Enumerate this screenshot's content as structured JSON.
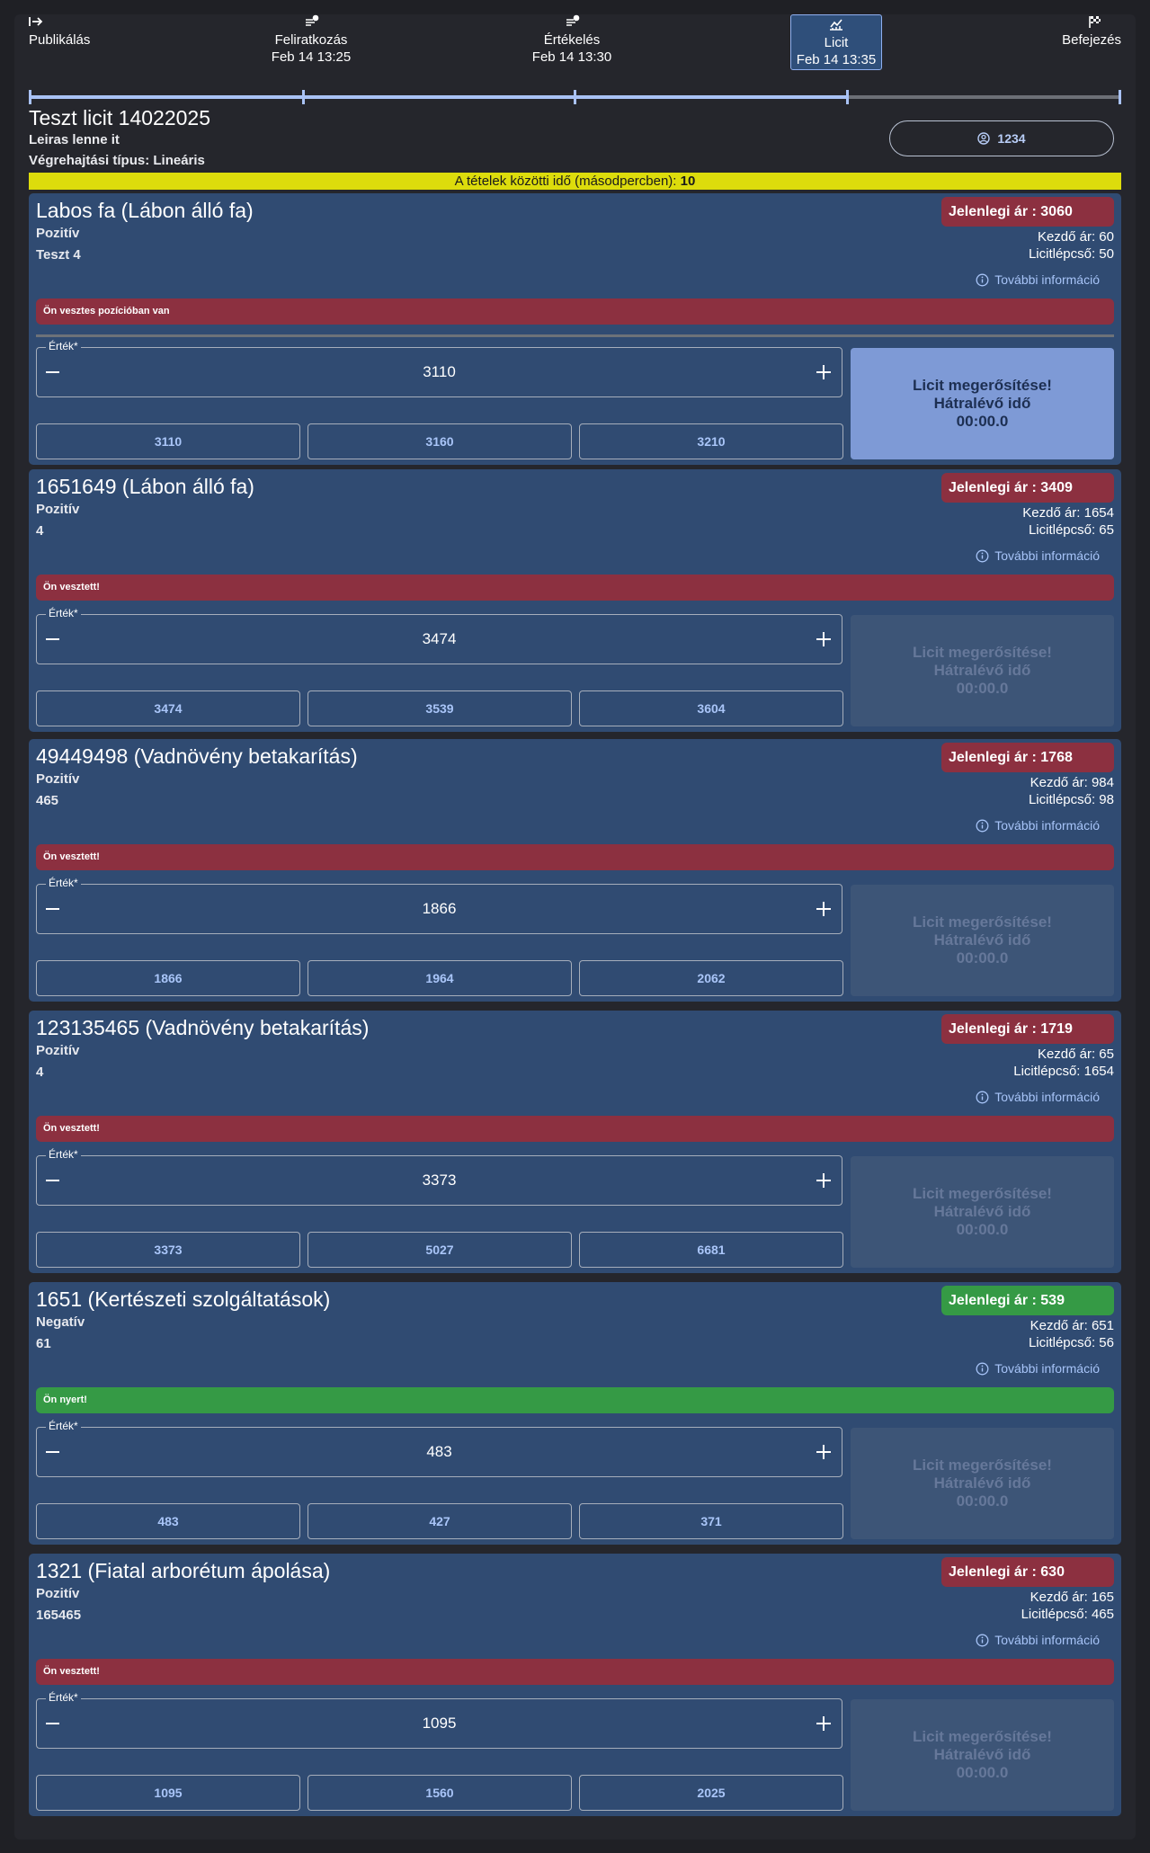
{
  "stepper": {
    "steps": [
      {
        "label": "Publikálás",
        "date": ""
      },
      {
        "label": "Feliratkozás",
        "date": "Feb 14 13:25"
      },
      {
        "label": "Értékelés",
        "date": "Feb 14 13:30"
      },
      {
        "label": "Licit",
        "date": "Feb 14 13:35"
      },
      {
        "label": "Befejezés",
        "date": ""
      }
    ],
    "active_index": 3
  },
  "header": {
    "title": "Teszt licit 14022025",
    "description": "Leiras lenne it",
    "type_label": "Végrehajtási típus: ",
    "type_value": "Lineáris",
    "user": "1234",
    "banner_text": "A tételek közötti idő (másodpercben): ",
    "banner_value": "10"
  },
  "labels": {
    "field": "Érték*",
    "info": "További információ",
    "confirm_line1": "Licit megerősítése!",
    "confirm_line2": "Hátralévő idő",
    "confirm_time": "00:00.0"
  },
  "colors": {
    "accent": "#a9c2f5",
    "lose": "#8c3040",
    "win": "#359a45",
    "banner": "#dddc0c"
  },
  "items": [
    {
      "title": "Labos fa (Lábon álló fa)",
      "type": "Pozitív",
      "sub": "Teszt 4",
      "price": "Jelenlegi ár : 3060",
      "start": "Kezdő ár: 60",
      "step": "Licitlépcső: 50",
      "status": "Ön vesztes pozícióban van",
      "win": false,
      "value": "3110",
      "quick": [
        "3110",
        "3160",
        "3210"
      ],
      "active": true
    },
    {
      "title": "1651649 (Lábon álló fa)",
      "type": "Pozitív",
      "sub": "4",
      "price": "Jelenlegi ár : 3409",
      "start": "Kezdő ár: 1654",
      "step": "Licitlépcső: 65",
      "status": "Ön vesztett!",
      "win": false,
      "value": "3474",
      "quick": [
        "3474",
        "3539",
        "3604"
      ],
      "active": false
    },
    {
      "title": "49449498 (Vadnövény betakarítás)",
      "type": "Pozitív",
      "sub": "465",
      "price": "Jelenlegi ár : 1768",
      "start": "Kezdő ár: 984",
      "step": "Licitlépcső: 98",
      "status": "Ön vesztett!",
      "win": false,
      "value": "1866",
      "quick": [
        "1866",
        "1964",
        "2062"
      ],
      "active": false
    },
    {
      "title": "123135465 (Vadnövény betakarítás)",
      "type": "Pozitív",
      "sub": "4",
      "price": "Jelenlegi ár : 1719",
      "start": "Kezdő ár: 65",
      "step": "Licitlépcső: 1654",
      "status": "Ön vesztett!",
      "win": false,
      "value": "3373",
      "quick": [
        "3373",
        "5027",
        "6681"
      ],
      "active": false
    },
    {
      "title": "1651 (Kertészeti szolgáltatások)",
      "type": "Negatív",
      "sub": "61",
      "price": "Jelenlegi ár : 539",
      "start": "Kezdő ár: 651",
      "step": "Licitlépcső: 56",
      "status": "Ön nyert!",
      "win": true,
      "value": "483",
      "quick": [
        "483",
        "427",
        "371"
      ],
      "active": false
    },
    {
      "title": "1321 (Fiatal arborétum ápolása)",
      "type": "Pozitív",
      "sub": "165465",
      "price": "Jelenlegi ár : 630",
      "start": "Kezdő ár: 165",
      "step": "Licitlépcső: 465",
      "status": "Ön vesztett!",
      "win": false,
      "value": "1095",
      "quick": [
        "1095",
        "1560",
        "2025"
      ],
      "active": false
    }
  ]
}
